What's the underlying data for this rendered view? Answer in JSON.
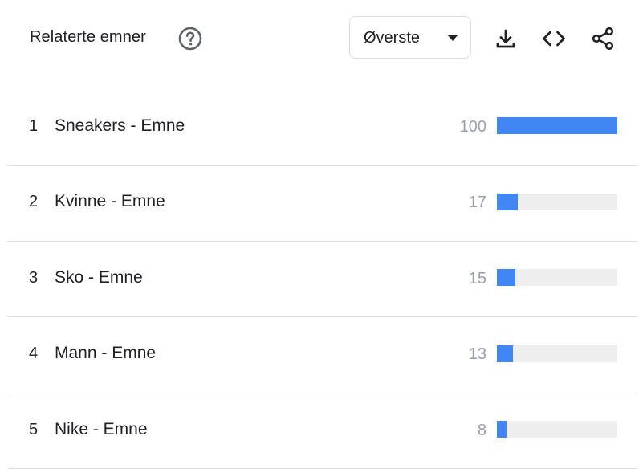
{
  "header": {
    "title": "Relaterte emner",
    "help_icon": "help-circle-icon",
    "dropdown": {
      "selected": "Øverste",
      "caret_icon": "caret-down-icon"
    },
    "tools": [
      "download-icon",
      "embed-code-icon",
      "share-icon"
    ]
  },
  "colors": {
    "bar_fill": "#4285f4",
    "bar_track": "#eeeeee",
    "value_text": "#9aa0a6",
    "divider": "#dadce0",
    "icon": "#5f6368"
  },
  "rows": [
    {
      "rank": "1",
      "term": "Sneakers - Emne",
      "value": "100",
      "fill": 1.0
    },
    {
      "rank": "2",
      "term": "Kvinne - Emne",
      "value": "17",
      "fill": 0.17
    },
    {
      "rank": "3",
      "term": "Sko - Emne",
      "value": "15",
      "fill": 0.15
    },
    {
      "rank": "4",
      "term": "Mann - Emne",
      "value": "13",
      "fill": 0.13
    },
    {
      "rank": "5",
      "term": "Nike - Emne",
      "value": "8",
      "fill": 0.08
    }
  ]
}
